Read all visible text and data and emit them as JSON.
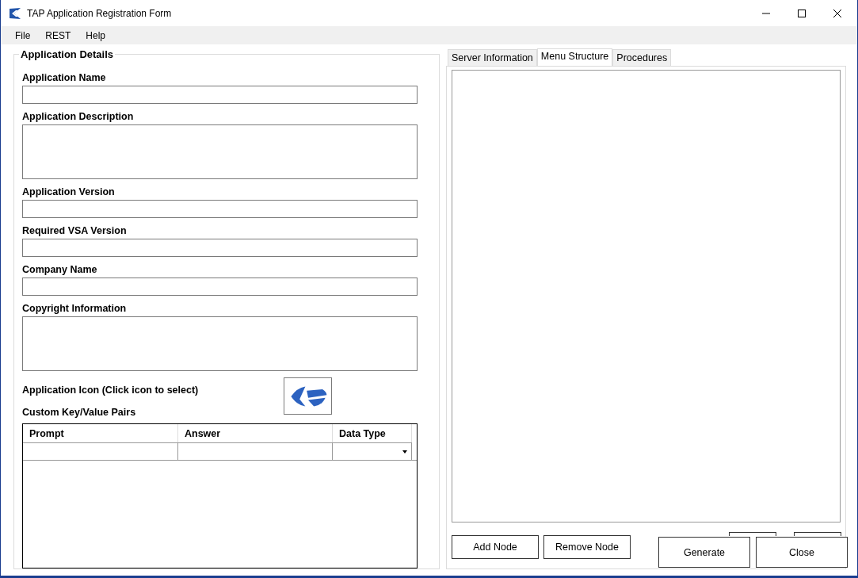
{
  "window": {
    "title": "TAP Application Registration Form"
  },
  "menu": [
    "File",
    "REST",
    "Help"
  ],
  "details": {
    "title": "Application Details",
    "fields": [
      {
        "label": "Application Name",
        "kind": "line"
      },
      {
        "label": "Application Description",
        "kind": "multi"
      },
      {
        "label": "Application Version",
        "kind": "line"
      },
      {
        "label": "Required VSA Version",
        "kind": "line"
      },
      {
        "label": "Company Name",
        "kind": "line"
      },
      {
        "label": "Copyright Information",
        "kind": "multi"
      }
    ],
    "icon_label": "Application Icon (Click icon to select)",
    "pairs_label": "Custom Key/Value Pairs",
    "table": {
      "columns": [
        "Prompt",
        "Answer",
        "Data Type"
      ]
    }
  },
  "tabs": [
    {
      "label": "Server Information",
      "selected": false
    },
    {
      "label": "Menu Structure",
      "selected": true
    },
    {
      "label": "Procedures",
      "selected": false
    }
  ],
  "tree_buttons": [
    "Add Node",
    "Remove Node"
  ],
  "footer_buttons": [
    "Generate",
    "Close"
  ]
}
